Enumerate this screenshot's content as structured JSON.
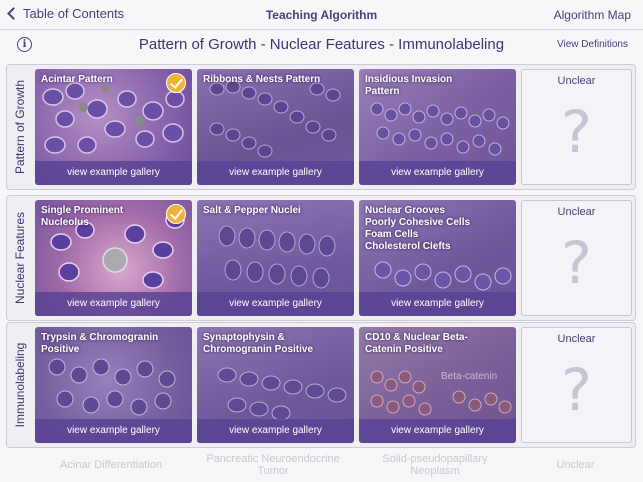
{
  "nav": {
    "back_label": "Table of Contents",
    "title": "Teaching Algorithm",
    "right_label": "Algorithm Map"
  },
  "header": {
    "info_icon": "i",
    "title": "Pattern of Growth - Nuclear Features - Immunolabeling",
    "view_definitions": "View Definitions"
  },
  "colors": {
    "accent": "#4a3f7a",
    "card_footer": "#5a4294",
    "check": "#f2b23a"
  },
  "rows": [
    {
      "label": "Pattern of Growth",
      "cards": [
        {
          "title": "Acintar Pattern",
          "footer": "view example gallery",
          "checked": true,
          "icon": "checkmark-icon"
        },
        {
          "title": "Ribbons & Nests Pattern",
          "footer": "view example gallery",
          "checked": false
        },
        {
          "title": "Insidious Invasion\nPattern",
          "footer": "view example gallery",
          "checked": false
        }
      ],
      "unclear": {
        "label": "Unclear",
        "symbol": "?"
      }
    },
    {
      "label": "Nuclear Features",
      "cards": [
        {
          "title": "Single Prominent\nNucleolus",
          "footer": "view example gallery",
          "checked": true,
          "icon": "checkmark-icon"
        },
        {
          "title": "Salt & Pepper Nuclei",
          "footer": "view example gallery",
          "checked": false
        },
        {
          "title": "Nuclear Grooves\nPoorly Cohesive Cells\nFoam Cells\nCholesterol Clefts",
          "footer": "view example gallery",
          "checked": false
        }
      ],
      "unclear": {
        "label": "Unclear",
        "symbol": "?"
      }
    },
    {
      "label": "Immunolabeling",
      "cards": [
        {
          "title": "Trypsin & Chromogranin\nPositive",
          "footer": "view example gallery",
          "checked": false
        },
        {
          "title": "Synaptophysin &\nChromogranin Positive",
          "footer": "view example gallery",
          "checked": false
        },
        {
          "title": "CD10 & Nuclear Beta-\nCatenin Positive",
          "footer": "view example gallery",
          "checked": false,
          "watermark": "Beta-catenin"
        }
      ],
      "unclear": {
        "label": "Unclear",
        "symbol": "?"
      }
    }
  ],
  "footer": [
    {
      "label": "Acinar Differentiation"
    },
    {
      "label": "Pancreatic Neuroendocrine\nTumor"
    },
    {
      "label": "Solid-pseudopapillary\nNeoplasm"
    },
    {
      "label": "Unclear"
    }
  ]
}
